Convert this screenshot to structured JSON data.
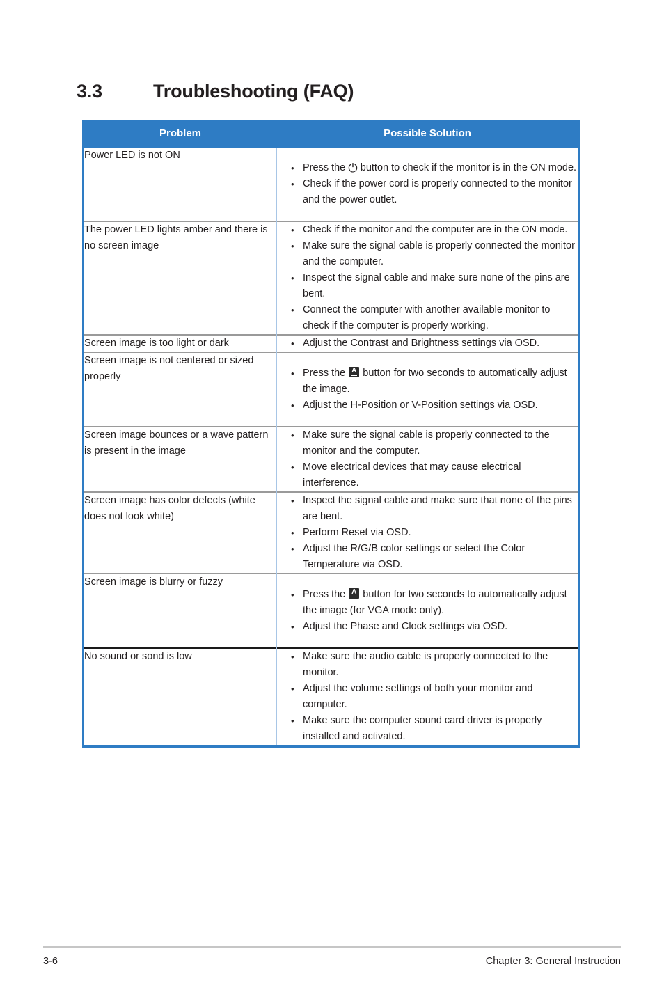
{
  "heading": {
    "number": "3.3",
    "title": "Troubleshooting (FAQ)"
  },
  "table": {
    "columns": {
      "problem": "Problem",
      "solution": "Possible Solution"
    },
    "rows": [
      {
        "problem": "Power  LED is not ON",
        "solutions": [
          {
            "before": "Press the ",
            "icon": "power-icon",
            "after": " button to check if the monitor is in the ON mode."
          },
          {
            "text": "Check if the power cord is properly connected to the monitor and the power outlet."
          }
        ]
      },
      {
        "problem": "The power LED lights amber and there is no screen image",
        "solutions": [
          {
            "text": "Check if the monitor and the computer are in the ON mode."
          },
          {
            "text": "Make sure the signal cable is properly connected the monitor and the computer."
          },
          {
            "text": "Inspect the signal cable and make sure none of the pins are bent."
          },
          {
            "text": "Connect the computer with another available monitor to check if the computer is properly working."
          }
        ]
      },
      {
        "problem": "Screen image is too light or dark",
        "solutions": [
          {
            "text": "Adjust the Contrast and Brightness settings via OSD."
          }
        ]
      },
      {
        "problem": "Screen image is not centered or sized properly",
        "solutions": [
          {
            "before": "Press the ",
            "icon": "auto-adjust-icon",
            "after": " button for two seconds to automatically adjust the image."
          },
          {
            "text": "Adjust the H-Position or V-Position settings via OSD."
          }
        ]
      },
      {
        "problem": "Screen image bounces or a wave pattern is present in the image",
        "solutions": [
          {
            "text": "Make sure the signal cable is properly connected to the monitor and the computer."
          },
          {
            "text": "Move electrical devices that may cause electrical interference."
          }
        ]
      },
      {
        "problem": "Screen image has color defects (white does not look white)",
        "solutions": [
          {
            "text": "Inspect the signal cable and make sure that none of the pins are bent."
          },
          {
            "text": "Perform Reset via OSD."
          },
          {
            "text": "Adjust the R/G/B color settings or select the Color Temperature via OSD."
          }
        ]
      },
      {
        "problem": "Screen image is blurry or fuzzy",
        "solutions": [
          {
            "before": "Press the ",
            "icon": "auto-adjust-icon",
            "after": " button for two seconds to automatically adjust the image (for VGA mode only)."
          },
          {
            "text": "Adjust the Phase and Clock settings via OSD."
          }
        ]
      },
      {
        "problem": "No sound or sond is low",
        "solutions": [
          {
            "text": "Make sure the audio cable is properly connected to the monitor."
          },
          {
            "text": "Adjust the volume settings of both your monitor and computer."
          },
          {
            "text": "Make sure the computer sound card driver is properly installed and activated."
          }
        ]
      }
    ]
  },
  "footer": {
    "page_number": "3-6",
    "chapter": "Chapter 3: General Instruction"
  },
  "colors": {
    "header_blue": "#2e7cc4",
    "column_divider": "#a8c6e6",
    "row_divider": "#9a9a9a",
    "text": "#231f20"
  }
}
